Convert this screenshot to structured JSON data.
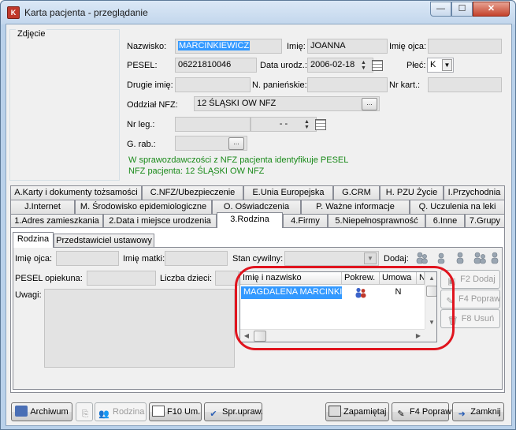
{
  "window": {
    "title": "Karta pacjenta - przeglądanie",
    "minimize_icon": "minimize-icon",
    "maximize_icon": "maximize-icon",
    "close_icon": "close-icon"
  },
  "photo": {
    "label": "Zdjęcie"
  },
  "patient": {
    "nazwisko_label": "Nazwisko:",
    "nazwisko": "MARCINKIEWICZ",
    "imie_label": "Imię:",
    "imie": "JOANNA",
    "imie_ojca_label": "Imię ojca:",
    "imie_ojca": "",
    "pesel_label": "PESEL:",
    "pesel": "06221810046",
    "data_urodz_label": "Data urodz.:",
    "data_urodz": "2006-02-18",
    "plec_label": "Płeć:",
    "plec": "K",
    "drugie_imie_label": "Drugie imię:",
    "drugie_imie": "",
    "n_panienskie_label": "N. panieńskie:",
    "n_panienskie": "",
    "nr_kart_label": "Nr kart.:",
    "nr_kart": "",
    "oddzial_nfz_label": "Oddział NFZ:",
    "oddzial_nfz": "12 ŚLĄSKI OW NFZ",
    "ellipsis": "...",
    "nr_leg_label": "Nr leg.:",
    "nr_leg": "",
    "nr_leg_date": "-  -",
    "g_rab_label": "G. rab.:",
    "g_rab": ""
  },
  "nfz_info": {
    "line1": "W sprawozdawczości z NFZ pacjenta identyfikuje PESEL",
    "line2": "NFZ pacjenta: 12 ŚLĄSKI OW NFZ"
  },
  "tabs": {
    "row1": [
      "A.Karty i dokumenty tożsamości",
      "C.NFZ/Ubezpieczenie",
      "E.Unia Europejska",
      "G.CRM",
      "H. PZU Życie",
      "I.Przychodnia"
    ],
    "row2": [
      "J.Internet",
      "M. Środowisko epidemiologiczne",
      "O. Oświadczenia",
      "P. Ważne informacje",
      "Q. Uczulenia na leki"
    ],
    "row3": [
      "1.Adres zamieszkania",
      "2.Data i miejsce urodzenia",
      "3.Rodzina",
      "4.Firmy",
      "5.Niepełnosprawność",
      "6.Inne",
      "7.Grupy"
    ]
  },
  "subtabs": [
    "Rodzina",
    "Przedstawiciel ustawowy"
  ],
  "rodzina": {
    "imie_ojca_label": "Imię ojca:",
    "imie_ojca": "",
    "imie_matki_label": "Imię matki:",
    "imie_matki": "",
    "stan_cywilny_label": "Stan cywilny:",
    "stan_cywilny": "",
    "dodaj_label": "Dodaj:",
    "pesel_opiekuna_label": "PESEL opiekuna:",
    "pesel_opiekuna": "",
    "liczba_dzieci_label": "Liczba dzieci:",
    "liczba_dzieci": "",
    "uwagi_label": "Uwagi:",
    "uwagi": ""
  },
  "family_grid": {
    "columns": [
      "Imię i nazwisko",
      "Pokrew.",
      "Umowa",
      "N"
    ],
    "rows": [
      {
        "name": "MAGDALENA MARCINKIEWICZ",
        "relation_icon": "family-icon",
        "umowa": "N"
      }
    ]
  },
  "side_buttons": {
    "add": "F2 Dodaj",
    "edit": "F4 Popraw",
    "delete": "F8 Usuń"
  },
  "bottom": {
    "archiwum": "Archiwum",
    "rodzina": "Rodzina",
    "f10": "F10 Um.",
    "spr": "Spr.upraw.",
    "zapamietaj": "Zapamiętaj",
    "f4": "F4 Popraw",
    "zamknij": "Zamknij"
  },
  "colors": {
    "selection": "#3399ff",
    "info_text": "#1a8a1a",
    "highlight_ring": "#e0141e"
  }
}
